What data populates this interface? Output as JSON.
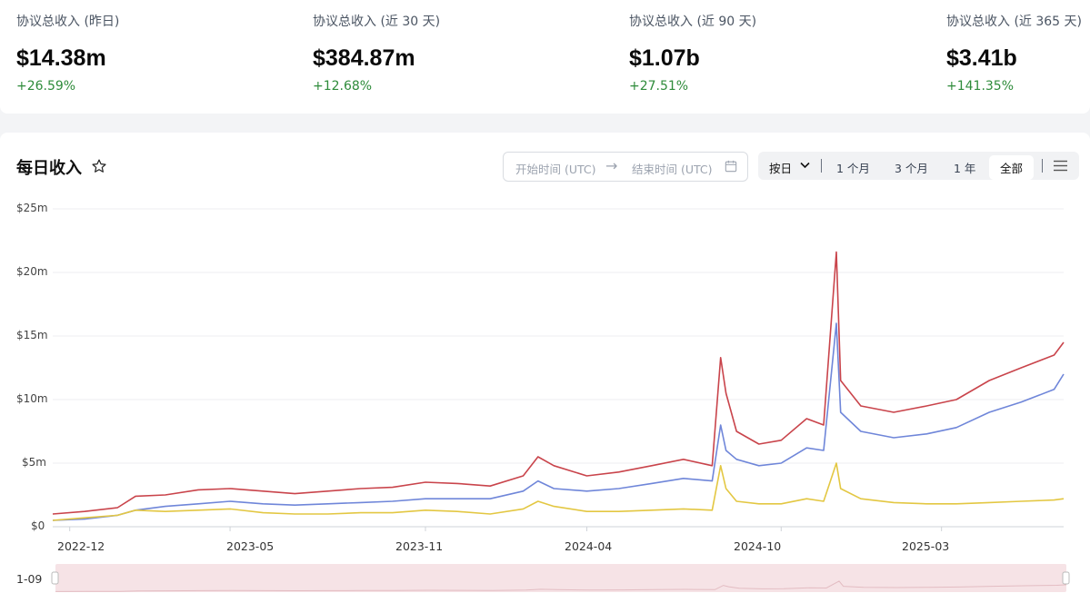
{
  "stats": [
    {
      "label": "协议总收入 (昨日)",
      "value": "$14.38m",
      "change": "+26.59%"
    },
    {
      "label": "协议总收入 (近 30 天)",
      "value": "$384.87m",
      "change": "+12.68%"
    },
    {
      "label": "协议总收入 (近 90 天)",
      "value": "$1.07b",
      "change": "+27.51%"
    },
    {
      "label": "协议总收入 (近 365 天)",
      "value": "$3.41b",
      "change": "+141.35%"
    }
  ],
  "panel": {
    "title": "每日收入",
    "date_start_placeholder": "开始时间 (UTC)",
    "date_end_placeholder": "结束时间 (UTC)",
    "granularity": "按日",
    "ranges": [
      "1 个月",
      "3 个月",
      "1 年",
      "全部"
    ],
    "selected_range": "全部",
    "slider_label": "1-09"
  },
  "colors": {
    "series_red": "#c9444b",
    "series_blue": "#6f86d9",
    "series_yellow": "#e3c742",
    "up": "#2e8b3a"
  },
  "icons": {
    "favorite": "star-icon",
    "calendar": "calendar-icon",
    "menu": "menu-icon",
    "dropdown": "chevron-down-icon"
  },
  "chart_data": {
    "type": "line",
    "y_ticks": [
      "$0",
      "$5m",
      "$10m",
      "$15m",
      "$20m",
      "$25m"
    ],
    "ylim": [
      0,
      25
    ],
    "x_ticks": [
      "2022-12",
      "2023-05",
      "2023-11",
      "2024-04",
      "2024-10",
      "2025-03"
    ],
    "x_tick_dates": [
      "2022-12-01",
      "2023-05-01",
      "2023-11-01",
      "2024-04-01",
      "2024-10-01",
      "2025-03-01"
    ],
    "x_range": [
      "2022-11-15",
      "2025-06-24"
    ],
    "grid": true,
    "legend": "none",
    "series": [
      {
        "color": "#c9444b",
        "points": [
          [
            "2022-11-15",
            1.0
          ],
          [
            "2022-12-15",
            1.2
          ],
          [
            "2023-01-15",
            1.5
          ],
          [
            "2023-02-01",
            2.4
          ],
          [
            "2023-03-01",
            2.5
          ],
          [
            "2023-04-01",
            2.9
          ],
          [
            "2023-05-01",
            3.0
          ],
          [
            "2023-06-01",
            2.8
          ],
          [
            "2023-07-01",
            2.6
          ],
          [
            "2023-08-01",
            2.8
          ],
          [
            "2023-09-01",
            3.0
          ],
          [
            "2023-10-01",
            3.1
          ],
          [
            "2023-11-01",
            3.5
          ],
          [
            "2023-12-01",
            3.4
          ],
          [
            "2024-01-01",
            3.2
          ],
          [
            "2024-02-01",
            4.0
          ],
          [
            "2024-02-15",
            5.5
          ],
          [
            "2024-03-01",
            4.8
          ],
          [
            "2024-04-01",
            4.0
          ],
          [
            "2024-05-01",
            4.3
          ],
          [
            "2024-06-01",
            4.8
          ],
          [
            "2024-07-01",
            5.3
          ],
          [
            "2024-07-28",
            4.8
          ],
          [
            "2024-08-05",
            13.3
          ],
          [
            "2024-08-10",
            10.5
          ],
          [
            "2024-08-20",
            7.5
          ],
          [
            "2024-09-10",
            6.5
          ],
          [
            "2024-10-01",
            6.8
          ],
          [
            "2024-10-25",
            8.5
          ],
          [
            "2024-11-10",
            8.0
          ],
          [
            "2024-11-22",
            21.6
          ],
          [
            "2024-11-26",
            11.5
          ],
          [
            "2024-12-15",
            9.5
          ],
          [
            "2025-01-15",
            9.0
          ],
          [
            "2025-02-15",
            9.5
          ],
          [
            "2025-03-15",
            10.0
          ],
          [
            "2025-04-15",
            11.5
          ],
          [
            "2025-05-15",
            12.5
          ],
          [
            "2025-06-15",
            13.5
          ],
          [
            "2025-06-24",
            14.5
          ]
        ]
      },
      {
        "color": "#6f86d9",
        "points": [
          [
            "2022-11-15",
            0.5
          ],
          [
            "2022-12-15",
            0.6
          ],
          [
            "2023-01-15",
            0.9
          ],
          [
            "2023-02-01",
            1.3
          ],
          [
            "2023-03-01",
            1.6
          ],
          [
            "2023-04-01",
            1.8
          ],
          [
            "2023-05-01",
            2.0
          ],
          [
            "2023-06-01",
            1.8
          ],
          [
            "2023-07-01",
            1.7
          ],
          [
            "2023-08-01",
            1.8
          ],
          [
            "2023-09-01",
            1.9
          ],
          [
            "2023-10-01",
            2.0
          ],
          [
            "2023-11-01",
            2.2
          ],
          [
            "2023-12-01",
            2.2
          ],
          [
            "2024-01-01",
            2.2
          ],
          [
            "2024-02-01",
            2.8
          ],
          [
            "2024-02-15",
            3.6
          ],
          [
            "2024-03-01",
            3.0
          ],
          [
            "2024-04-01",
            2.8
          ],
          [
            "2024-05-01",
            3.0
          ],
          [
            "2024-06-01",
            3.4
          ],
          [
            "2024-07-01",
            3.8
          ],
          [
            "2024-07-28",
            3.6
          ],
          [
            "2024-08-05",
            8.0
          ],
          [
            "2024-08-10",
            6.0
          ],
          [
            "2024-08-20",
            5.3
          ],
          [
            "2024-09-10",
            4.8
          ],
          [
            "2024-10-01",
            5.0
          ],
          [
            "2024-10-25",
            6.2
          ],
          [
            "2024-11-10",
            6.0
          ],
          [
            "2024-11-22",
            16.0
          ],
          [
            "2024-11-26",
            9.0
          ],
          [
            "2024-12-15",
            7.5
          ],
          [
            "2025-01-15",
            7.0
          ],
          [
            "2025-02-15",
            7.3
          ],
          [
            "2025-03-15",
            7.8
          ],
          [
            "2025-04-15",
            9.0
          ],
          [
            "2025-05-15",
            9.8
          ],
          [
            "2025-06-15",
            10.8
          ],
          [
            "2025-06-24",
            12.0
          ]
        ]
      },
      {
        "color": "#e3c742",
        "points": [
          [
            "2022-11-15",
            0.5
          ],
          [
            "2022-12-15",
            0.7
          ],
          [
            "2023-01-15",
            0.9
          ],
          [
            "2023-02-01",
            1.3
          ],
          [
            "2023-03-01",
            1.2
          ],
          [
            "2023-04-01",
            1.3
          ],
          [
            "2023-05-01",
            1.4
          ],
          [
            "2023-06-01",
            1.1
          ],
          [
            "2023-07-01",
            1.0
          ],
          [
            "2023-08-01",
            1.0
          ],
          [
            "2023-09-01",
            1.1
          ],
          [
            "2023-10-01",
            1.1
          ],
          [
            "2023-11-01",
            1.3
          ],
          [
            "2023-12-01",
            1.2
          ],
          [
            "2024-01-01",
            1.0
          ],
          [
            "2024-02-01",
            1.4
          ],
          [
            "2024-02-15",
            2.0
          ],
          [
            "2024-03-01",
            1.6
          ],
          [
            "2024-04-01",
            1.2
          ],
          [
            "2024-05-01",
            1.2
          ],
          [
            "2024-06-01",
            1.3
          ],
          [
            "2024-07-01",
            1.4
          ],
          [
            "2024-07-28",
            1.3
          ],
          [
            "2024-08-05",
            4.8
          ],
          [
            "2024-08-10",
            3.0
          ],
          [
            "2024-08-20",
            2.0
          ],
          [
            "2024-09-10",
            1.8
          ],
          [
            "2024-10-01",
            1.8
          ],
          [
            "2024-10-25",
            2.2
          ],
          [
            "2024-11-10",
            2.0
          ],
          [
            "2024-11-22",
            5.0
          ],
          [
            "2024-11-26",
            3.0
          ],
          [
            "2024-12-15",
            2.2
          ],
          [
            "2025-01-15",
            1.9
          ],
          [
            "2025-02-15",
            1.8
          ],
          [
            "2025-03-15",
            1.8
          ],
          [
            "2025-04-15",
            1.9
          ],
          [
            "2025-05-15",
            2.0
          ],
          [
            "2025-06-15",
            2.1
          ],
          [
            "2025-06-24",
            2.2
          ]
        ]
      }
    ]
  }
}
